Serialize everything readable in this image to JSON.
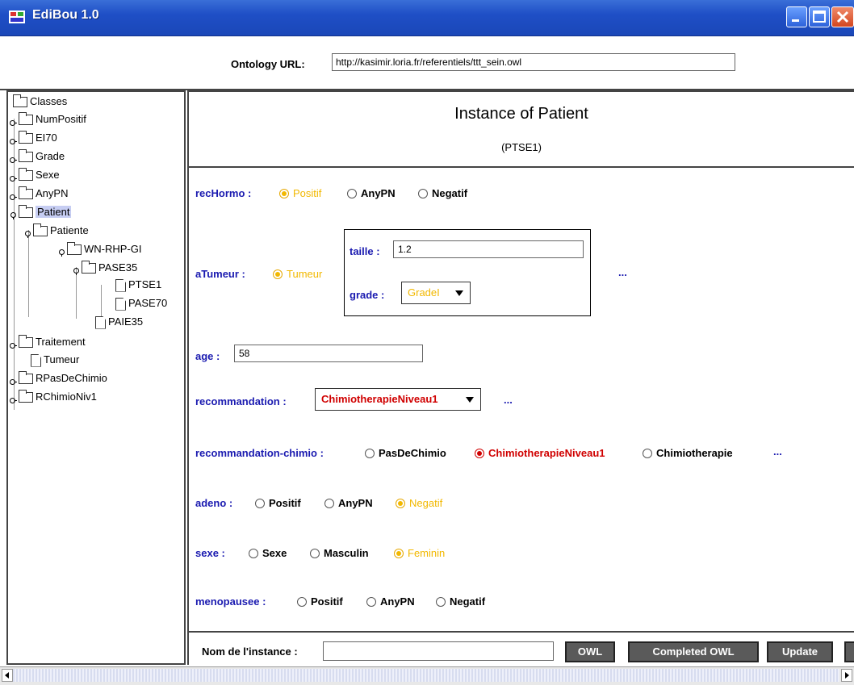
{
  "window": {
    "title": "EdiBou 1.0"
  },
  "ontology": {
    "label": "Ontology URL:",
    "value": "http://kasimir.loria.fr/referentiels/ttt_sein.owl"
  },
  "tree": [
    {
      "label": "Classes",
      "icon": "folder-icon",
      "expander": "none"
    },
    {
      "label": "NumPositif",
      "icon": "folder-icon",
      "expander": "collapsed"
    },
    {
      "label": "EI70",
      "icon": "folder-icon",
      "expander": "collapsed"
    },
    {
      "label": "Grade",
      "icon": "folder-icon",
      "expander": "collapsed"
    },
    {
      "label": "Sexe",
      "icon": "folder-icon",
      "expander": "collapsed"
    },
    {
      "label": "AnyPN",
      "icon": "folder-icon",
      "expander": "collapsed"
    },
    {
      "label": "Patient",
      "icon": "folder-icon",
      "expander": "expanded",
      "selected": true
    },
    {
      "label": "Patiente",
      "icon": "folder-icon",
      "expander": "expanded"
    },
    {
      "label": "WN-RHP-GI",
      "icon": "folder-icon",
      "expander": "expanded"
    },
    {
      "label": "PASE35",
      "icon": "folder-icon",
      "expander": "expanded"
    },
    {
      "label": "PTSE1",
      "icon": "file-icon",
      "expander": "none"
    },
    {
      "label": "PASE70",
      "icon": "file-icon",
      "expander": "none"
    },
    {
      "label": "PAIE35",
      "icon": "file-icon",
      "expander": "none"
    },
    {
      "label": "Traitement",
      "icon": "folder-icon",
      "expander": "collapsed"
    },
    {
      "label": "Tumeur",
      "icon": "file-icon",
      "expander": "none"
    },
    {
      "label": "RPasDeChimio",
      "icon": "folder-icon",
      "expander": "collapsed"
    },
    {
      "label": "RChimioNiv1",
      "icon": "folder-icon",
      "expander": "collapsed"
    }
  ],
  "instance": {
    "title": "Instance of Patient",
    "id": "(PTSE1)"
  },
  "props": {
    "recHormo": {
      "label": "recHormo :",
      "options": [
        "Positif",
        "AnyPN",
        "Negatif"
      ],
      "selected": "Positif"
    },
    "aTumeur": {
      "label": "aTumeur :",
      "option": "Tumeur",
      "more": "...",
      "taille_label": "taille :",
      "taille_value": "1.2",
      "grade_label": "grade :",
      "grade_value": "GradeI"
    },
    "age": {
      "label": "age :",
      "value": "58"
    },
    "recommandation": {
      "label": "recommandation :",
      "value": "ChimiotherapieNiveau1",
      "more": "..."
    },
    "recommandation_chimio": {
      "label": "recommandation-chimio :",
      "options": [
        "PasDeChimio",
        "ChimiotherapieNiveau1",
        "Chimiotherapie"
      ],
      "selected": "ChimiotherapieNiveau1",
      "more": "..."
    },
    "adeno": {
      "label": "adeno :",
      "options": [
        "Positif",
        "AnyPN",
        "Negatif"
      ],
      "selected": "Negatif"
    },
    "sexe": {
      "label": "sexe :",
      "options": [
        "Sexe",
        "Masculin",
        "Feminin"
      ],
      "selected": "Feminin"
    },
    "menopausee": {
      "label": "menopausee :",
      "options": [
        "Positif",
        "AnyPN",
        "Negatif"
      ],
      "selected": ""
    }
  },
  "footer": {
    "name_label": "Nom de l'instance :",
    "name_value": "",
    "btn_owl": "OWL",
    "btn_completed": "Completed OWL",
    "btn_update": "Update"
  },
  "colors": {
    "label_blue": "#1a1ab0",
    "selected_yellow": "#f2b800",
    "selected_red": "#d00000",
    "title_bar": "#1f4fc6"
  }
}
